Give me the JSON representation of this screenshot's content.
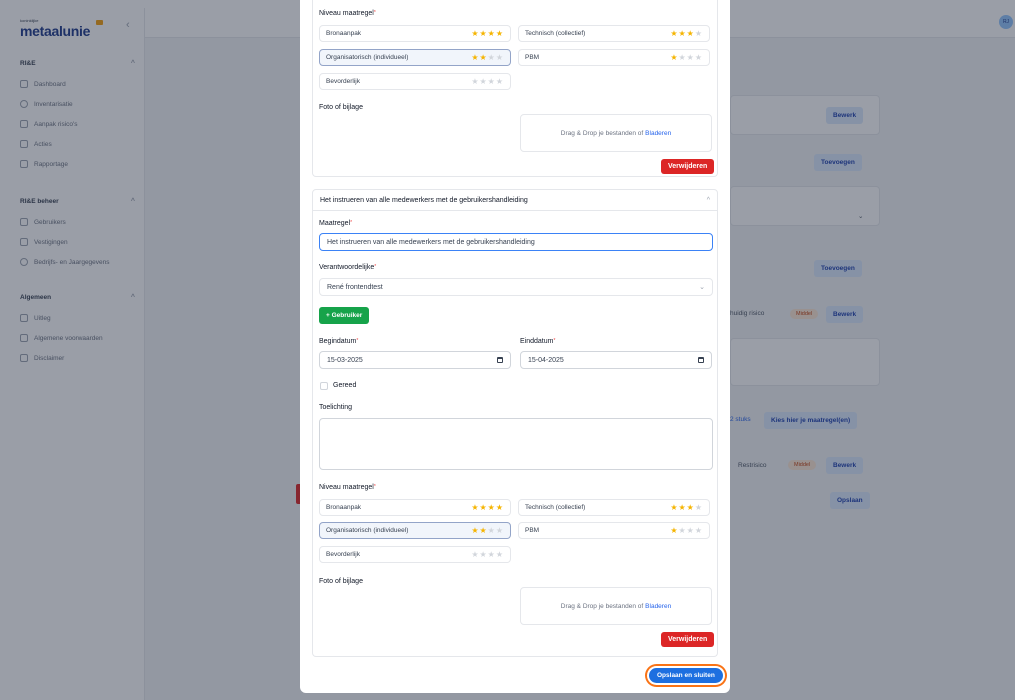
{
  "app": {
    "logo_small": "koninklijke",
    "logo_main": "metaalunie",
    "avatar": "RJ",
    "sidebar": {
      "groups": [
        {
          "title": "RI&E",
          "items": [
            "Dashboard",
            "Inventarisatie",
            "Aanpak risico's",
            "Acties",
            "Rapportage"
          ]
        },
        {
          "title": "RI&E beheer",
          "items": [
            "Gebruikers",
            "Vestigingen",
            "Bedrijfs- en Jaargegevens"
          ]
        },
        {
          "title": "Algemeen",
          "items": [
            "Uitleg",
            "Algemene voorwaarden",
            "Disclaimer"
          ]
        }
      ]
    },
    "background": {
      "bewerk_1": "Bewerk",
      "toevoegen_1": "Toevoegen",
      "toevoegen_2": "Toevoegen",
      "huidig_risico": "huidig risico",
      "badge_1": "Middel",
      "bewerk_2": "Bewerk",
      "stuks": "2 stuks",
      "kies_maatregel": "Kies hier je maatregel(en)",
      "restrisico": "Restrisico",
      "badge_2": "Middel",
      "bewerk_3": "Bewerk",
      "opslaan": "Opslaan"
    }
  },
  "modal": {
    "top": {
      "niveau_label": "Niveau maatregel",
      "ratings": [
        {
          "label": "Bronaanpak",
          "stars": 4
        },
        {
          "label": "Technisch (collectief)",
          "stars": 3
        },
        {
          "label": "Organisatorisch (individueel)",
          "stars": 2
        },
        {
          "label": "PBM",
          "stars": 1
        },
        {
          "label": "Bevorderlijk",
          "stars": 0
        }
      ],
      "foto_label": "Foto of bijlage",
      "dropzone_text": "Drag & Drop je bestanden of",
      "dropzone_link": "Bladeren",
      "delete_button": "Verwijderen"
    },
    "second": {
      "header": "Het instrueren van alle medewerkers met de gebruikershandleiding",
      "maatregel_label": "Maatregel",
      "maatregel_value": "Het instrueren van alle medewerkers met de gebruikershandleiding",
      "verantwoordelijke_label": "Verantwoordelijke",
      "verantwoordelijke_value": "René frontendtest",
      "add_user_button": "+ Gebruiker",
      "begindatum_label": "Begindatum",
      "begindatum_value": "15-03-2025",
      "einddatum_label": "Einddatum",
      "einddatum_value": "15-04-2025",
      "gereed_label": "Gereed",
      "toelichting_label": "Toelichting",
      "niveau_label": "Niveau maatregel",
      "ratings": [
        {
          "label": "Bronaanpak",
          "stars": 4
        },
        {
          "label": "Technisch (collectief)",
          "stars": 3
        },
        {
          "label": "Organisatorisch (individueel)",
          "stars": 2
        },
        {
          "label": "PBM",
          "stars": 1
        },
        {
          "label": "Bevorderlijk",
          "stars": 0
        }
      ],
      "foto_label": "Foto of bijlage",
      "dropzone_text": "Drag & Drop je bestanden of",
      "dropzone_link": "Bladeren",
      "delete_button": "Verwijderen"
    },
    "save_close_button": "Opslaan en sluiten"
  }
}
